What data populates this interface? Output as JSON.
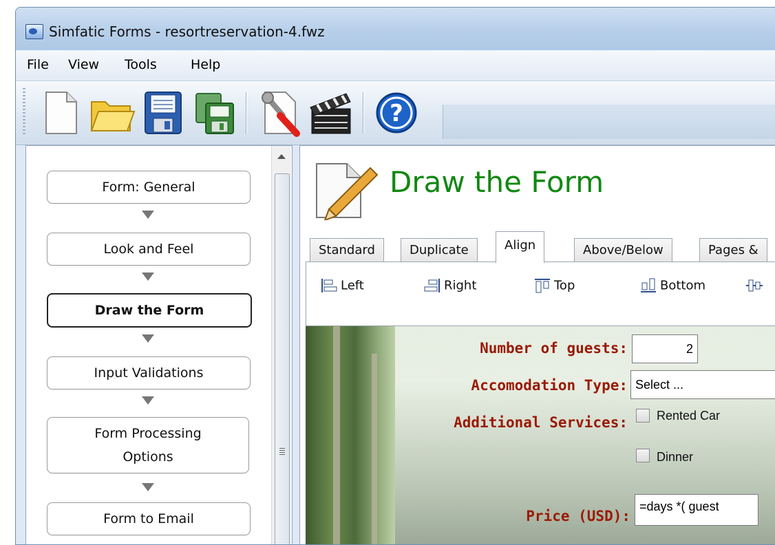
{
  "window": {
    "title": "Simfatic Forms - resortreservation-4.fwz"
  },
  "menu": [
    {
      "label": "File"
    },
    {
      "label": "View"
    },
    {
      "label": "Tools"
    },
    {
      "label": "Help"
    }
  ],
  "toolbar": {
    "buttons": [
      {
        "icon": "new-document-icon"
      },
      {
        "icon": "open-folder-icon"
      },
      {
        "icon": "save-icon"
      },
      {
        "icon": "save-as-icon"
      },
      {
        "icon": "settings-tools-icon"
      },
      {
        "icon": "clapperboard-icon"
      },
      {
        "icon": "help-icon"
      }
    ]
  },
  "nav": {
    "steps": [
      {
        "label": "Form: General"
      },
      {
        "label": "Look and Feel"
      },
      {
        "label": "Draw the Form",
        "active": true
      },
      {
        "label": "Input Validations"
      },
      {
        "label": "Form Processing Options"
      },
      {
        "label": "Form to Email"
      }
    ]
  },
  "content": {
    "heading": "Draw the Form",
    "tabs": [
      {
        "label": "Standard"
      },
      {
        "label": "Duplicate"
      },
      {
        "label": "Align",
        "active": true
      },
      {
        "label": "Above/Below"
      },
      {
        "label": "Pages &"
      }
    ],
    "align_buttons": [
      {
        "label": "Left"
      },
      {
        "label": "Right"
      },
      {
        "label": "Top"
      },
      {
        "label": "Bottom"
      },
      {
        "label": ""
      }
    ],
    "form": {
      "guests_label": "Number of guests:",
      "guests_value": "2",
      "accommodation_label": "Accomodation Type:",
      "accommodation_value": "Select ...",
      "services_label": "Additional Services:",
      "service_car": "Rented Car",
      "service_dinner": "Dinner",
      "price_label": "Price (USD):",
      "price_value": "=days *( guest"
    }
  },
  "colors": {
    "heading": "#118811",
    "form_label": "#9a1a05",
    "window_frame": "#6d8fb3"
  }
}
